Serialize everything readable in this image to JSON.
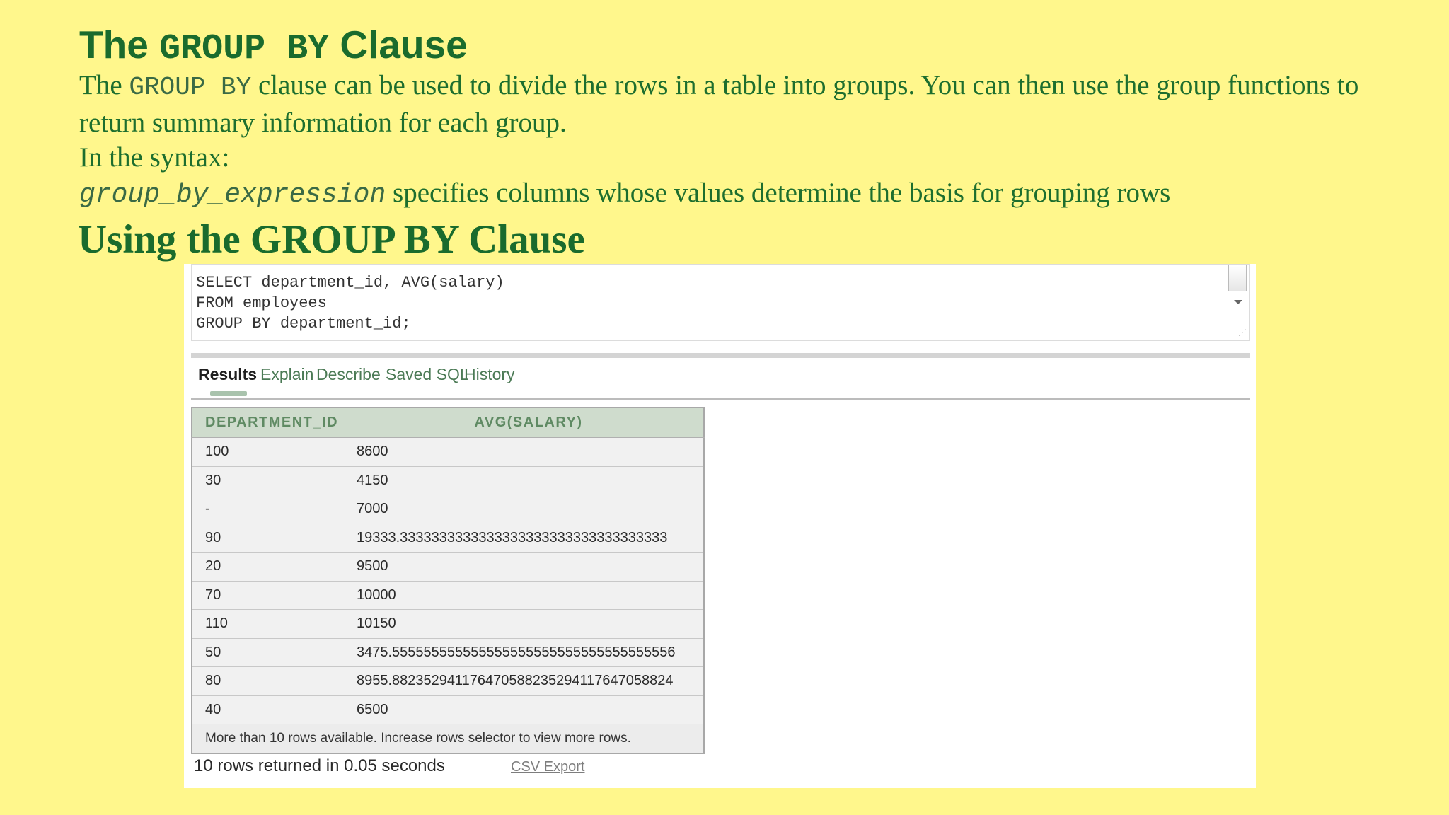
{
  "heading": {
    "pre": "The ",
    "code": "GROUP BY",
    "post": " Clause"
  },
  "intro": {
    "p1_pre": "The ",
    "p1_code": "GROUP BY",
    "p1_post": " clause can be used to divide the rows in a table into groups. You can then use the group functions to return summary information for each group.",
    "p2": "In the syntax:",
    "p3_code": "group_by_expression",
    "p3_post": " specifies columns whose values determine the basis for grouping rows"
  },
  "heading2": "Using the GROUP BY Clause",
  "editor": {
    "lines": [
      "SELECT department_id, AVG(salary)",
      "FROM employees",
      "GROUP BY department_id;"
    ]
  },
  "tabs": [
    "Results",
    "Explain",
    "Describe",
    "Saved SQL",
    "History"
  ],
  "results": {
    "columns": [
      "DEPARTMENT_ID",
      "AVG(SALARY)"
    ],
    "rows": [
      [
        "100",
        "8600"
      ],
      [
        "30",
        "4150"
      ],
      [
        "-",
        "7000"
      ],
      [
        "90",
        "19333.3333333333333333333333333333333333"
      ],
      [
        "20",
        "9500"
      ],
      [
        "70",
        "10000"
      ],
      [
        "110",
        "10150"
      ],
      [
        "50",
        "3475.555555555555555555555555555555555556"
      ],
      [
        "80",
        "8955.882352941176470588235294117647058824"
      ],
      [
        "40",
        "6500"
      ]
    ],
    "message": "More than 10 rows available. Increase rows selector to view more rows."
  },
  "footer": {
    "rows_returned": "10 rows returned in 0.05 seconds",
    "csv_export": "CSV Export"
  }
}
